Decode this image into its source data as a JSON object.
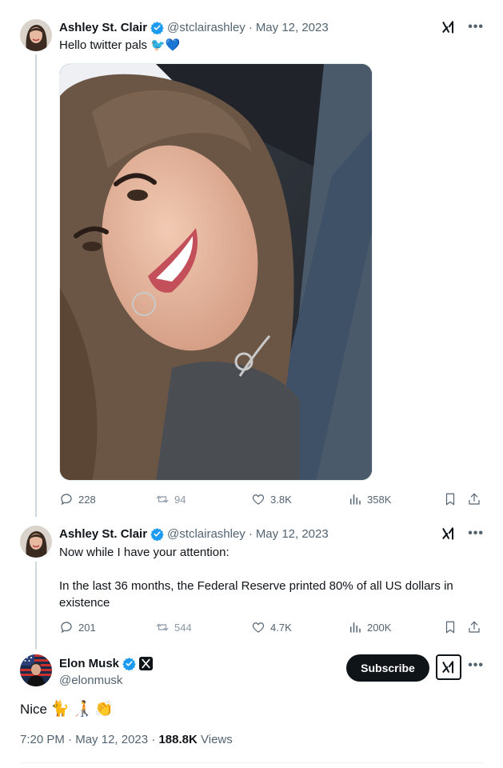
{
  "tweets": [
    {
      "name": "Ashley St. Clair",
      "handle": "@stclairashley",
      "separator": "·",
      "date": "May 12, 2023",
      "text": "Hello twitter pals 🐦💙",
      "stats": {
        "replies": "228",
        "retweets": "94",
        "likes": "3.8K",
        "views": "358K"
      }
    },
    {
      "name": "Ashley St. Clair",
      "handle": "@stclairashley",
      "separator": "·",
      "date": "May 12, 2023",
      "text_line1": "Now while I have your attention:",
      "text_line2": "In the last 36 months, the Federal Reserve printed 80% of all US dollars in",
      "text_line3": "existence",
      "stats": {
        "replies": "201",
        "retweets": "544",
        "likes": "4.7K",
        "views": "200K"
      }
    }
  ],
  "main_post": {
    "name": "Elon Musk",
    "handle": "@elonmusk",
    "subscribe_label": "Subscribe",
    "text": "Nice",
    "emojis": [
      "🐈",
      "🧑‍🦯",
      "👏"
    ],
    "time": "7:20 PM",
    "separator": "·",
    "date": "May 12, 2023",
    "separator2": "·",
    "views_count": "188.8K",
    "views_label": "Views"
  },
  "icons": [
    "verified-badge-icon",
    "grok-icon",
    "more-icon",
    "reply-icon",
    "retweet-icon",
    "like-icon",
    "views-icon",
    "bookmark-icon",
    "share-icon",
    "x-logo-icon"
  ],
  "colors": {
    "verified": "#1d9bf0",
    "text": "#0f1419",
    "muted": "#536471",
    "thread_line": "#cfd9de",
    "subscribe_bg": "#0f1419"
  }
}
